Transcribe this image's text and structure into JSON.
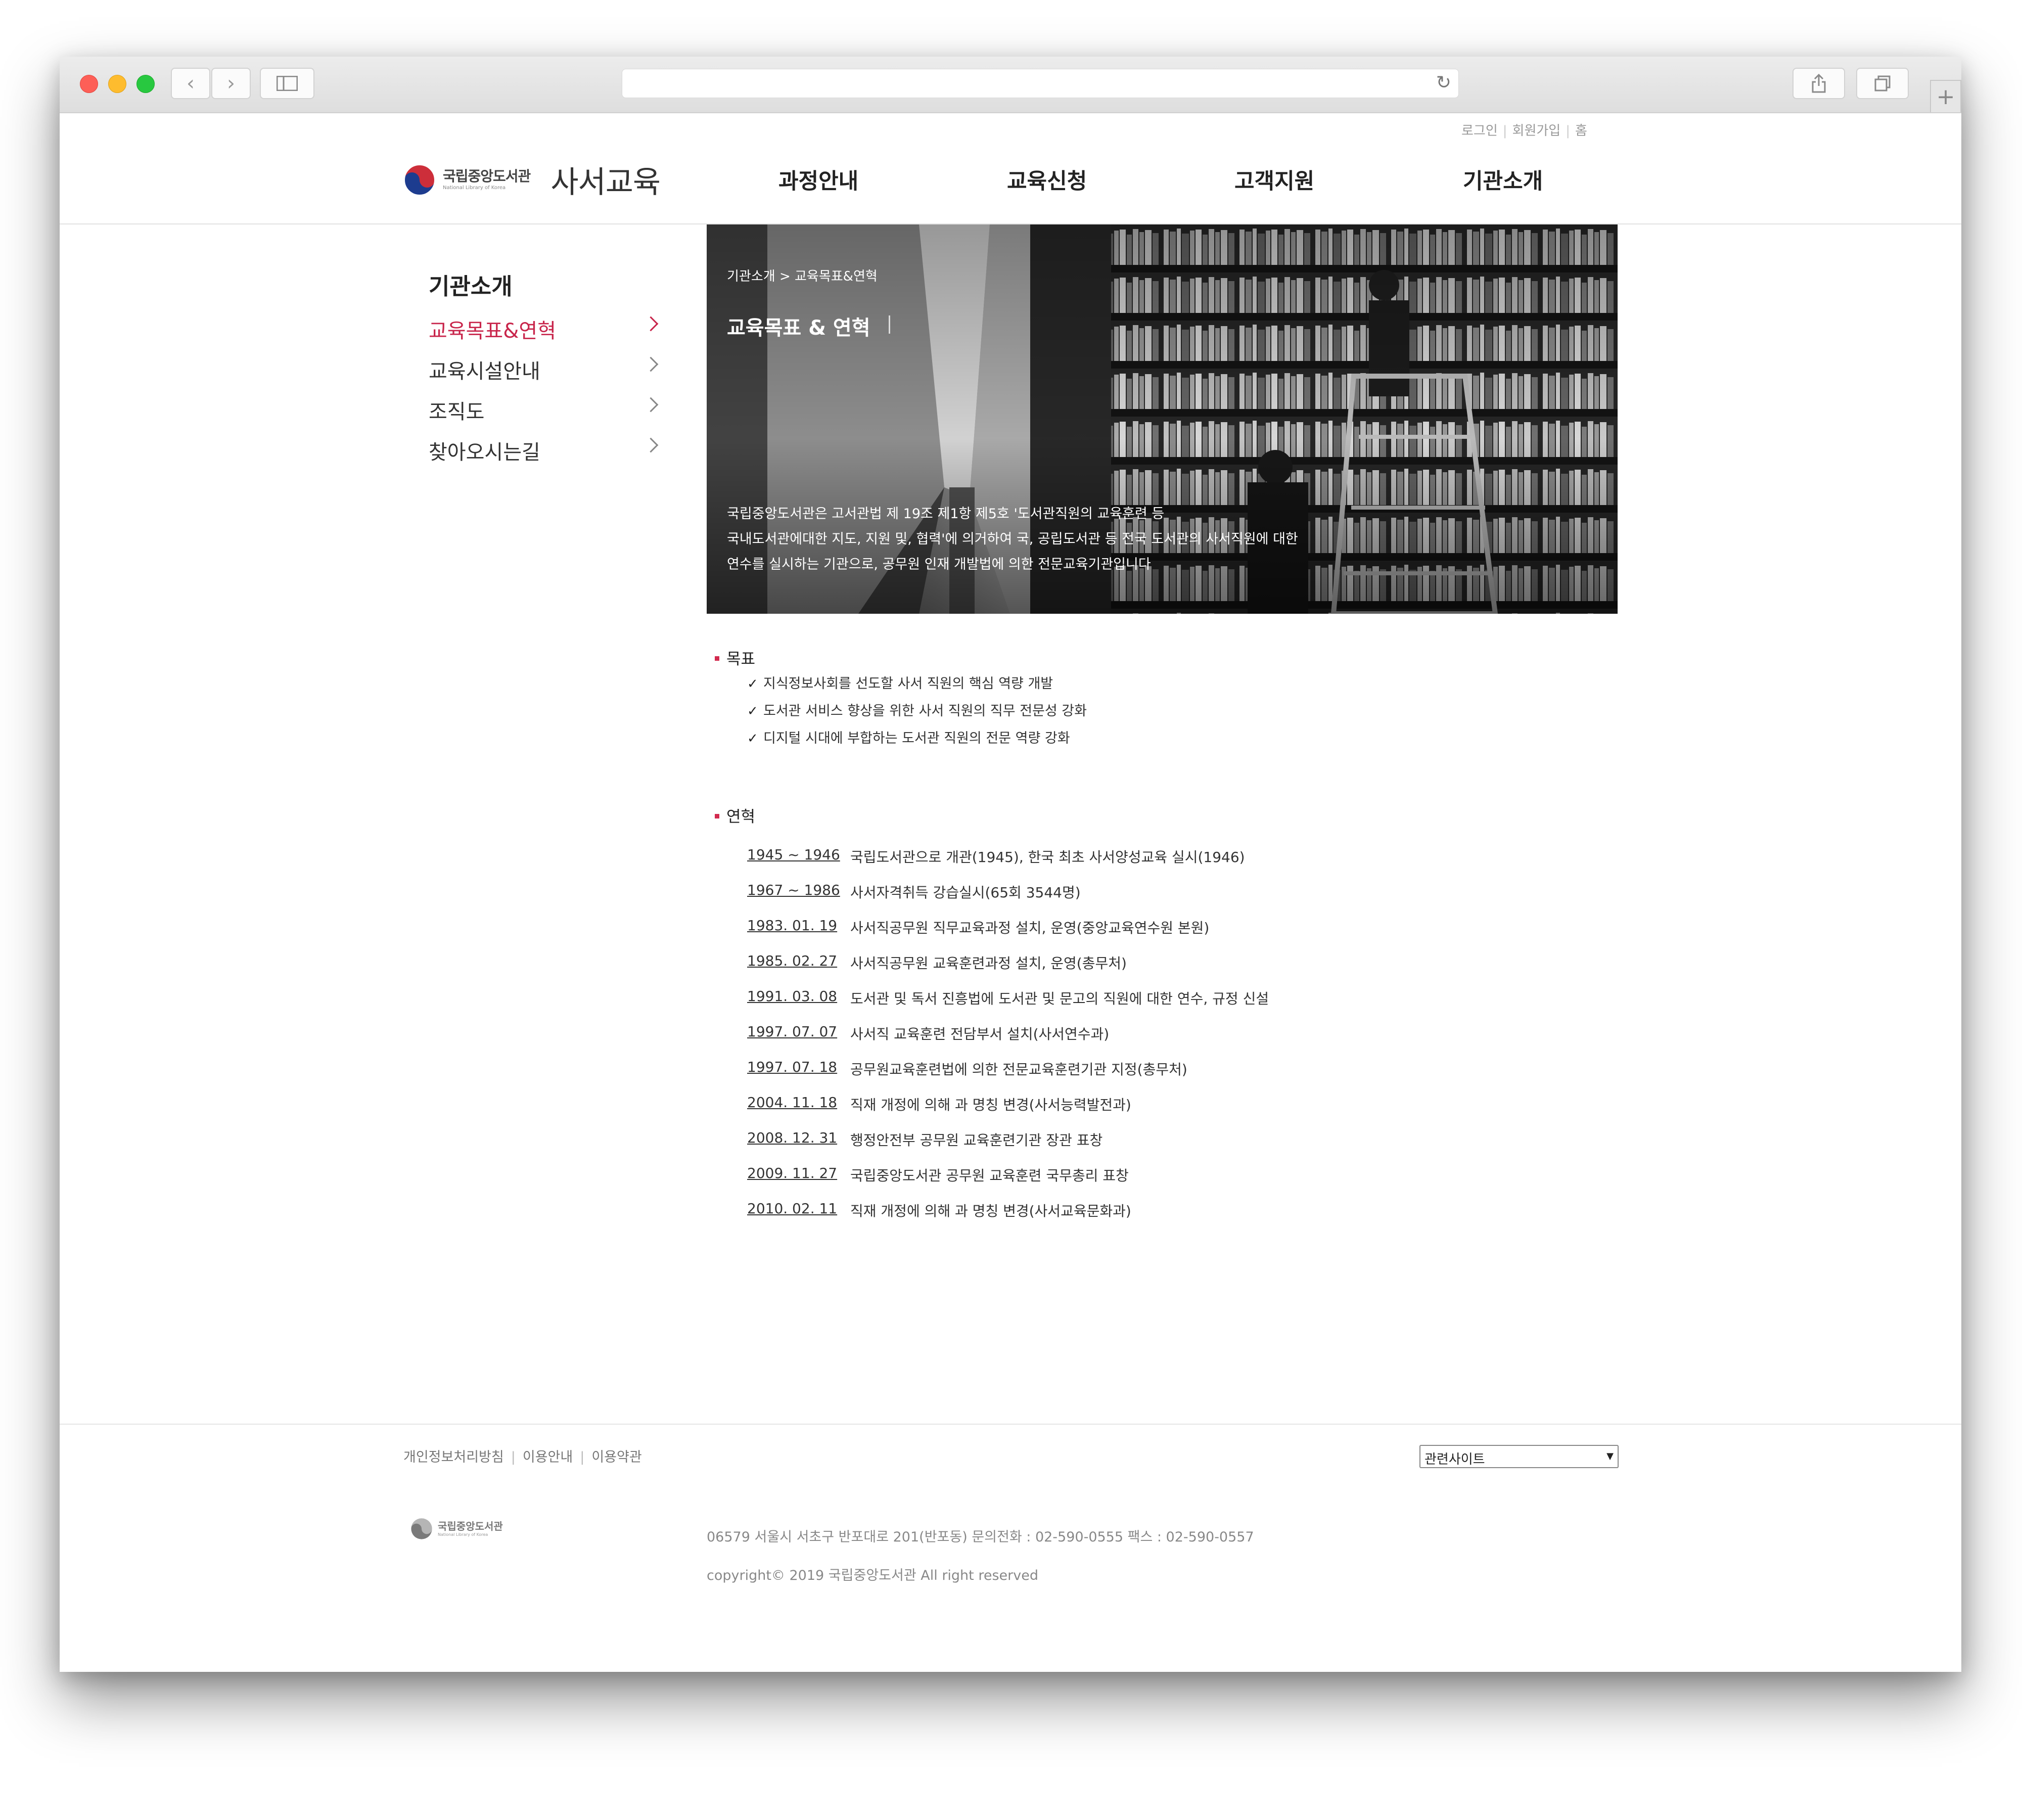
{
  "utility_links": [
    "로그인",
    "회원가입",
    "홈"
  ],
  "logo": {
    "name_kr": "국립중앙도서관",
    "name_en": "National Library of Korea",
    "title": "사서교육"
  },
  "gnb": [
    "과정안내",
    "교육신청",
    "고객지원",
    "기관소개"
  ],
  "sidebar": {
    "title": "기관소개",
    "items": [
      {
        "label": "교육목표&연혁",
        "active": true
      },
      {
        "label": "교육시설안내",
        "active": false
      },
      {
        "label": "조직도",
        "active": false
      },
      {
        "label": "찾아오시는길",
        "active": false
      }
    ]
  },
  "hero": {
    "breadcrumb": "기관소개 > 교육목표&연혁",
    "title": "교육목표 & 연혁",
    "description": [
      "국립중앙도서관은 고서관법 제 19조 제1항 제5호 '도서관직원의 교육훈련 등",
      "국내도서관에대한 지도, 지원 및, 협력'에 의거하여 국, 공립도서관 등 전국 도서관의 사서직원에 대한",
      "연수를 실시하는 기관으로, 공무원 인재 개발법에 의한 전문교육기관입니다"
    ]
  },
  "goals": {
    "heading": "목표",
    "items": [
      "지식정보사회를 선도할 사서 직원의 핵심 역량 개발",
      "도서관 서비스 향상을 위한 사서 직원의 직무 전문성 강화",
      "디지털 시대에 부합하는 도서관 직원의 전문 역량 강화"
    ]
  },
  "history": {
    "heading": "연혁",
    "items": [
      {
        "date": "1945 ~ 1946",
        "text": "국립도서관으로 개관(1945), 한국 최초 사서양성교육 실시(1946)"
      },
      {
        "date": "1967 ~ 1986",
        "text": "사서자격취득 강습실시(65회 3544명)"
      },
      {
        "date": "1983. 01. 19",
        "text": "사서직공무원 직무교육과정 설치, 운영(중앙교육연수원 본원)"
      },
      {
        "date": "1985. 02. 27",
        "text": "사서직공무원 교육훈련과정 설치, 운영(총무처)"
      },
      {
        "date": "1991. 03. 08",
        "text": "도서관 및 독서 진흥법에 도서관 및 문고의 직원에 대한 연수, 규정 신설"
      },
      {
        "date": "1997. 07. 07",
        "text": "사서직 교육훈련 전담부서 설치(사서연수과)"
      },
      {
        "date": "1997. 07. 18",
        "text": "공무원교육훈련법에 의한 전문교육훈련기관 지정(총무처)"
      },
      {
        "date": "2004. 11. 18",
        "text": "직재 개정에 의해 과 명칭 변경(사서능력발전과)"
      },
      {
        "date": "2008. 12. 31",
        "text": "행정안전부 공무원 교육훈련기관 장관 표창"
      },
      {
        "date": "2009. 11. 27",
        "text": "국립중앙도서관 공무원 교육훈련 국무총리 표창"
      },
      {
        "date": "2010. 02. 11",
        "text": "직재 개정에 의해 과 명칭 변경(사서교육문화과)"
      }
    ]
  },
  "footer": {
    "links": [
      "개인정보처리방침",
      "이용안내",
      "이용약관"
    ],
    "related_select": "관련사이트",
    "logo_kr": "국립중앙도서관",
    "logo_en": "National Library of Korea",
    "address": "06579 서울시 서초구 반포대로 201(반포동) 문의전화 : 02-590-0555 팩스 : 02-590-0557",
    "copyright": "copyright© 2019 국립중앙도서관 All right reserved"
  },
  "colors": {
    "accent": "#c8254b",
    "bullet": "#d22a4e"
  }
}
